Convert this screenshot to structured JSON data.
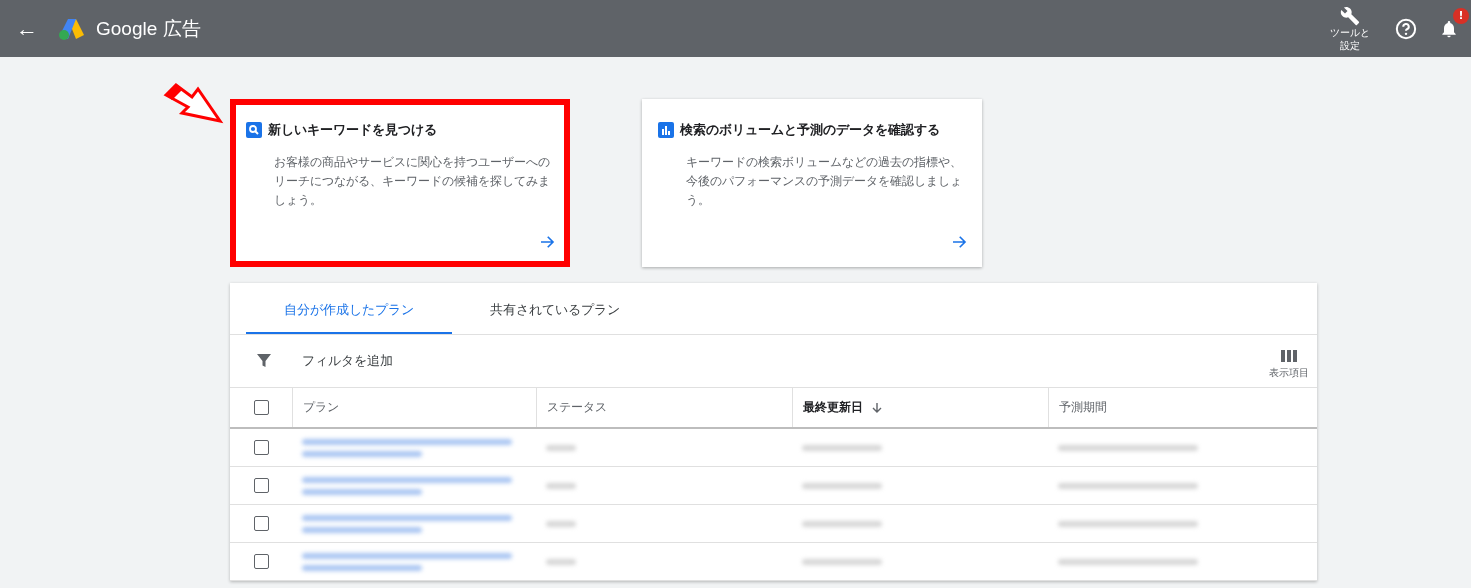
{
  "top_bar": {
    "back": "←",
    "logo_text": "Google 広告",
    "tools_label": "ツールと設定",
    "notification_badge": "!"
  },
  "cards": [
    {
      "kind": "search",
      "title": "新しいキーワードを見つける",
      "description": "お客様の商品やサービスに関心を持つユーザーへのリーチにつながる、キーワードの候補を探してみましょう。",
      "highlighted": true
    },
    {
      "kind": "chart",
      "title": "検索のボリュームと予測のデータを確認する",
      "description": "キーワードの検索ボリュームなどの過去の指標や、今後のパフォーマンスの予測データを確認しましょう。",
      "highlighted": false
    }
  ],
  "tabs": [
    {
      "label": "自分が作成したプラン",
      "selected": true
    },
    {
      "label": "共有されているプラン",
      "selected": false
    }
  ],
  "toolbar": {
    "filter_label": "フィルタを追加",
    "columns_label": "表示項目"
  },
  "table": {
    "select_all_checked": false,
    "columns": [
      {
        "label": "プラン",
        "sorted": false
      },
      {
        "label": "ステータス",
        "sorted": false
      },
      {
        "label": "最終更新日",
        "sorted": true
      },
      {
        "label": "予測期間",
        "sorted": false
      }
    ],
    "rows": [
      {
        "checked": false
      },
      {
        "checked": false
      },
      {
        "checked": false
      },
      {
        "checked": false
      }
    ]
  }
}
